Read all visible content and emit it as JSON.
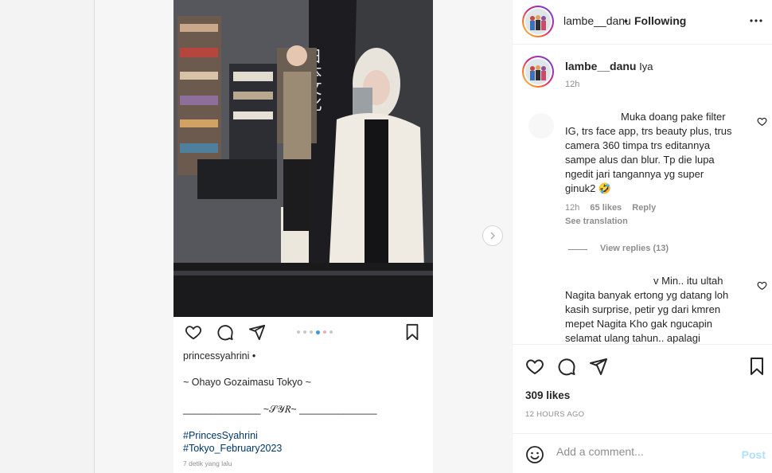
{
  "post": {
    "caption": {
      "username": "princessyahrini",
      "separator": "•",
      "line1": "~ Ohayo Gozaimasu Tokyo ~",
      "line2": "______________ ~𝒮𝒴𝑅~ ______________",
      "tags": [
        "#PrincesSyahrini",
        "#Tokyo_February2023"
      ],
      "time": "7 detik yang lalu"
    },
    "photo_sign": "日本文化"
  },
  "header": {
    "username": "lambe__danu",
    "separator": "•",
    "follow_label": "Following"
  },
  "comments": [
    {
      "username": "lambe__danu",
      "text": "Iya",
      "time": "12h"
    },
    {
      "text_lines": [
        "Muka doang pake filter",
        "IG, trs face app, trs beauty plus, trus",
        "camera 360 timpa trs editannya",
        "sampe alus dan blur. Tp die lupa",
        "ngedit jari tangannya yg super",
        "ginuk2 🤣"
      ],
      "time": "12h",
      "likes": "65 likes",
      "reply_label": "Reply",
      "translation_label": "See translation",
      "view_replies": "View replies (13)"
    },
    {
      "text_lines": [
        "v Min.. itu ultah",
        "Nagita banyak ertong yg datang loh",
        "kasih surprise, petir yg dari kmren",
        "mepet Nagita Kho gak ngucapin",
        "selamat ulang tahun.. apalagi"
      ]
    }
  ],
  "likes": "309 likes",
  "posted": "12 HOURS AGO",
  "add_comment": {
    "placeholder": "Add a comment...",
    "post_label": "Post"
  },
  "colors": {
    "link": "#00376b",
    "post_disabled": "#b2dffc",
    "carousel_active": "#3897f0"
  }
}
